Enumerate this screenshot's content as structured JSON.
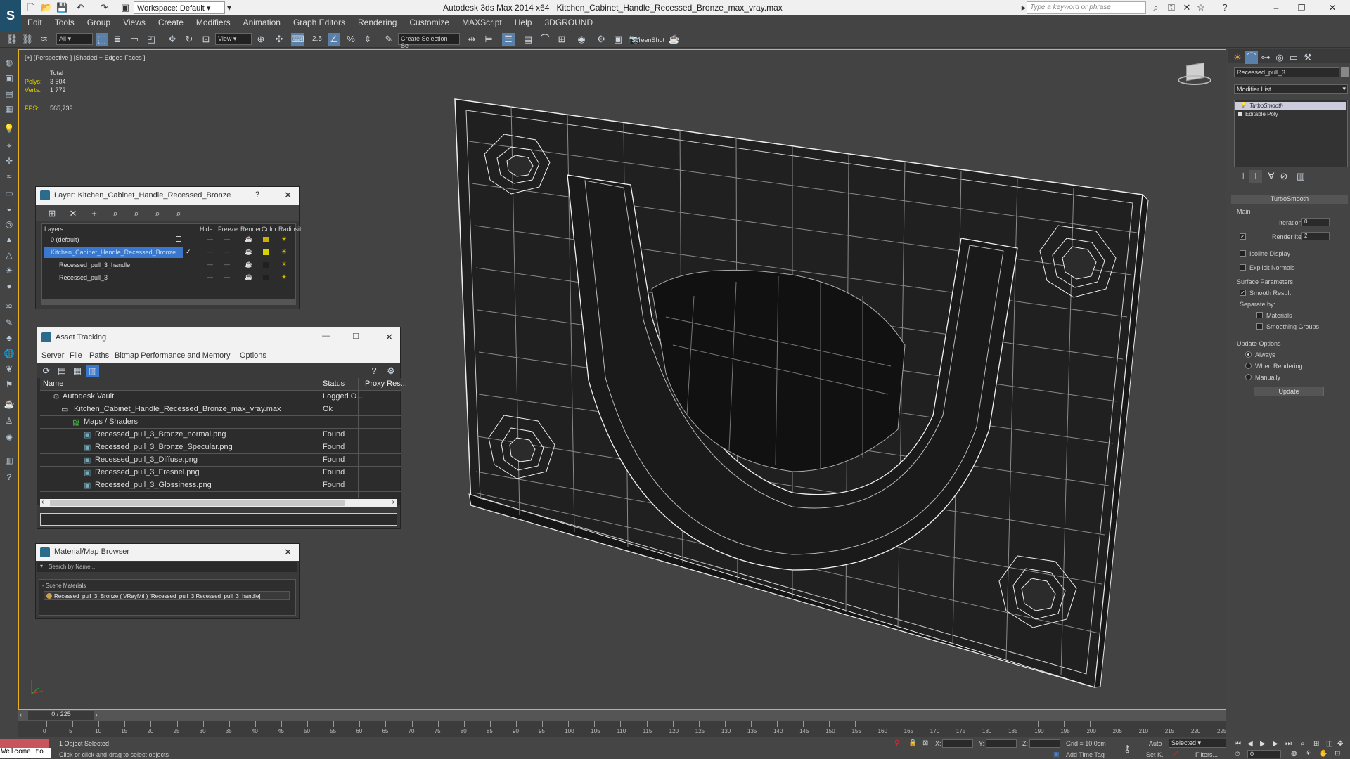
{
  "titlebar": {
    "app": "Autodesk 3ds Max  2014 x64",
    "file": "Kitchen_Cabinet_Handle_Recessed_Bronze_max_vray.max",
    "workspace": "Workspace: Default",
    "search_placeholder": "Type a keyword or phrase"
  },
  "menu": [
    "Edit",
    "Tools",
    "Group",
    "Views",
    "Create",
    "Modifiers",
    "Animation",
    "Graph Editors",
    "Rendering",
    "Customize",
    "MAXScript",
    "Help",
    "3DGROUND"
  ],
  "toolbar": {
    "filter": "All",
    "view": "View",
    "selection_set": "Create Selection Se",
    "screenshot": "ScreenShot",
    "snap_label": "2.5"
  },
  "viewport": {
    "label": "[+] [Perspective ] [Shaded + Edged Faces ]",
    "stats": {
      "total_label": "Total",
      "polys_label": "Polys:",
      "polys": "3 504",
      "verts_label": "Verts:",
      "verts": "1 772",
      "fps_label": "FPS:",
      "fps": "565,739"
    }
  },
  "layer_window": {
    "title": "Layer: Kitchen_Cabinet_Handle_Recessed_Bronze",
    "help": "?",
    "headers": [
      "Layers",
      "Hide",
      "Freeze",
      "Render",
      "Color",
      "Radiosit"
    ],
    "rows": [
      {
        "name": "0 (default)",
        "indent": 0,
        "selected": false,
        "color": "#c8b400"
      },
      {
        "name": "Kitchen_Cabinet_Handle_Recessed_Bronze",
        "indent": 0,
        "selected": true,
        "color": "#d4d400"
      },
      {
        "name": "Recessed_pull_3_handle",
        "indent": 1,
        "selected": false,
        "color": "#202020"
      },
      {
        "name": "Recessed_pull_3",
        "indent": 1,
        "selected": false,
        "color": "#202020"
      }
    ]
  },
  "asset_window": {
    "title": "Asset Tracking",
    "menu": [
      "Server",
      "File",
      "Paths",
      "Bitmap Performance and Memory",
      "Options"
    ],
    "headers": {
      "name": "Name",
      "status": "Status",
      "proxy": "Proxy Res..."
    },
    "rows": [
      {
        "name": "Autodesk Vault",
        "status": "Logged O...",
        "indent": 1
      },
      {
        "name": "Kitchen_Cabinet_Handle_Recessed_Bronze_max_vray.max",
        "status": "Ok",
        "indent": 2
      },
      {
        "name": "Maps / Shaders",
        "status": "",
        "indent": 3
      },
      {
        "name": "Recessed_pull_3_Bronze_normal.png",
        "status": "Found",
        "indent": 4
      },
      {
        "name": "Recessed_pull_3_Bronze_Specular.png",
        "status": "Found",
        "indent": 4
      },
      {
        "name": "Recessed_pull_3_Diffuse.png",
        "status": "Found",
        "indent": 4
      },
      {
        "name": "Recessed_pull_3_Fresnel.png",
        "status": "Found",
        "indent": 4
      },
      {
        "name": "Recessed_pull_3_Glossiness.png",
        "status": "Found",
        "indent": 4
      }
    ]
  },
  "material_window": {
    "title": "Material/Map Browser",
    "search_placeholder": "Search by Name ...",
    "section": "- Scene Materials",
    "item": "Recessed_pull_3_Bronze ( VRayMtl ) [Recessed_pull_3,Recessed_pull_3_handle]"
  },
  "command_panel": {
    "object_name": "Recessed_pull_3",
    "modifier_list": "Modifier List",
    "stack": [
      "TurboSmooth",
      "Editable Poly"
    ],
    "rollout_title": "TurboSmooth",
    "main_label": "Main",
    "iterations_label": "Iterations:",
    "iterations": "0",
    "render_iters_label": "Render Iters:",
    "render_iters": "2",
    "isoline": "Isoline Display",
    "explicit": "Explicit Normals",
    "surface_label": "Surface Parameters",
    "smooth_result": "Smooth Result",
    "separate_by": "Separate by:",
    "materials": "Materials",
    "smoothing_groups": "Smoothing Groups",
    "update_label": "Update Options",
    "always": "Always",
    "when_rendering": "When Rendering",
    "manually": "Manually",
    "update_button": "Update"
  },
  "timeline": {
    "frame": "0 / 225",
    "ticks": [
      "0",
      "5",
      "10",
      "15",
      "20",
      "25",
      "30",
      "35",
      "40",
      "45",
      "50",
      "55",
      "60",
      "65",
      "70",
      "75",
      "80",
      "85",
      "90",
      "95",
      "100",
      "105",
      "110",
      "115",
      "120",
      "125",
      "130",
      "135",
      "140",
      "145",
      "150",
      "155",
      "160",
      "165",
      "170",
      "175",
      "180",
      "185",
      "190",
      "195",
      "200",
      "205",
      "210",
      "215",
      "220",
      "225"
    ]
  },
  "status": {
    "welcome": "Welcome to",
    "selected": "1 Object Selected",
    "prompt": "Click or click-and-drag to select objects",
    "x_label": "X:",
    "y_label": "Y:",
    "z_label": "Z:",
    "grid": "Grid = 10,0cm",
    "add_time_tag": "Add Time Tag",
    "auto": "Auto",
    "set_key": "Set K.",
    "selected_dd": "Selected",
    "filters": "Filters...",
    "frame_value": "0"
  }
}
